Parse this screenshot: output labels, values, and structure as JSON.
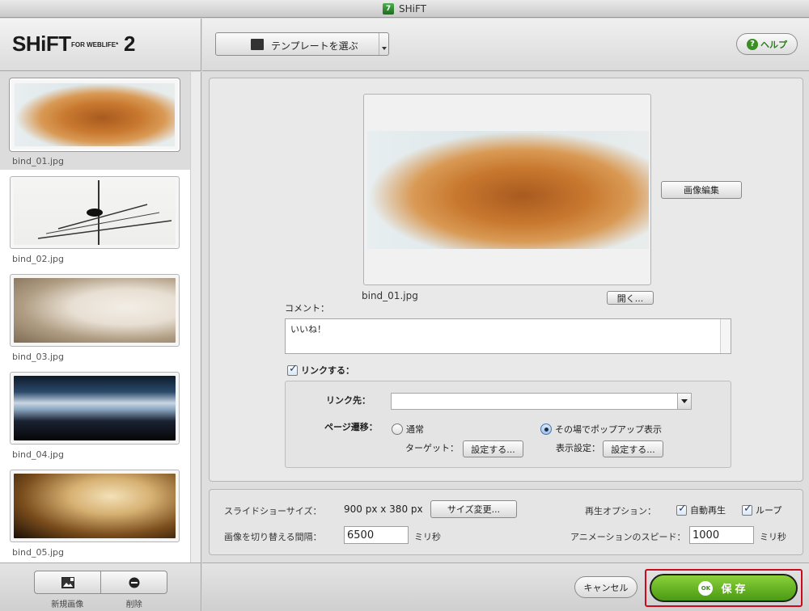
{
  "window": {
    "title": "SHiFT",
    "app_icon": "7"
  },
  "logo": {
    "name": "SHiFT",
    "sub": "FOR WEBLIFE*",
    "version": "2"
  },
  "toolbar": {
    "template_label": "テンプレートを選ぶ",
    "help_label": "ヘルプ"
  },
  "thumbnails": [
    {
      "label": "bind_01.jpg",
      "selected": true
    },
    {
      "label": "bind_02.jpg"
    },
    {
      "label": "bind_03.jpg"
    },
    {
      "label": "bind_04.jpg"
    },
    {
      "label": "bind_05.jpg"
    }
  ],
  "left_footer": {
    "new_image_label": "新規画像",
    "delete_label": "削除"
  },
  "editor": {
    "edit_image_label": "画像編集",
    "filename": "bind_01.jpg",
    "open_label": "開く...",
    "comment_label": "コメント：",
    "comment_value": "いいね！",
    "link_check_label": "リンクする：",
    "link_dest_label": "リンク先：",
    "page_transition_label": "ページ遷移：",
    "normal_label": "通常",
    "popup_label": "その場でポップアップ表示",
    "target_label": "ターゲット：",
    "target_button": "設定する...",
    "display_settings_label": "表示設定：",
    "display_settings_button": "設定する..."
  },
  "settings": {
    "slideshow_size_label": "スライドショーサイズ：",
    "slideshow_size_value": "900 px x 380 px",
    "resize_button": "サイズ変更...",
    "playback_label": "再生オプション：",
    "autoplay_label": "自動再生",
    "loop_label": "ループ",
    "interval_label": "画像を切り替える間隔：",
    "interval_value": "6500",
    "interval_unit": "ミリ秒",
    "anim_speed_label": "アニメーションのスピード：",
    "anim_speed_value": "1000",
    "anim_speed_unit": "ミリ秒"
  },
  "footer": {
    "cancel_label": "キャンセル",
    "ok_badge": "OK",
    "save_label": "保存"
  },
  "colors": {
    "save_green": "#5aa61c",
    "highlight_red": "#cc0a1e",
    "accent_green": "#3a8f22"
  }
}
